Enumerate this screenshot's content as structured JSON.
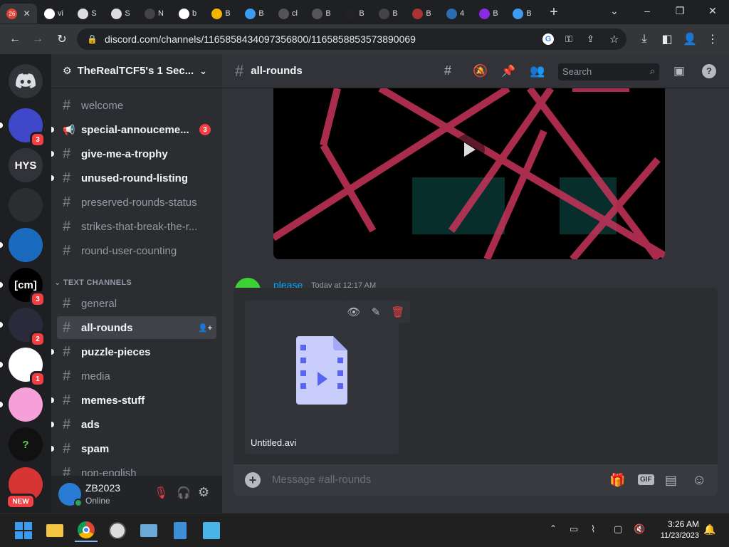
{
  "browser": {
    "tabs": [
      {
        "label": "",
        "badge": "26"
      },
      {
        "label": "vi"
      },
      {
        "label": "S"
      },
      {
        "label": "S"
      },
      {
        "label": "N"
      },
      {
        "label": "b"
      },
      {
        "label": "B"
      },
      {
        "label": "B"
      },
      {
        "label": "cl"
      },
      {
        "label": "B"
      },
      {
        "label": "B"
      },
      {
        "label": "B"
      },
      {
        "label": "B"
      },
      {
        "label": "4"
      },
      {
        "label": "B"
      },
      {
        "label": "B"
      }
    ],
    "url": "discord.com/channels/1165858434097356800/1165858853573890069"
  },
  "servers": [
    {
      "label": "",
      "badge": "3"
    },
    {
      "label": "HYS",
      "badge": ""
    },
    {
      "label": "",
      "badge": ""
    },
    {
      "label": "",
      "badge": ""
    },
    {
      "label": "[cm]",
      "badge": "3"
    },
    {
      "label": "",
      "badge": "2"
    },
    {
      "label": "",
      "badge": "1"
    },
    {
      "label": "",
      "badge": ""
    },
    {
      "label": "?",
      "badge": ""
    },
    {
      "label": "",
      "badge": "NEW"
    }
  ],
  "guild": {
    "name": "TheRealTCF5's 1 Sec..."
  },
  "channels_top": [
    {
      "name": "welcome",
      "state": "read",
      "badge": ""
    },
    {
      "name": "special-annoucеme...",
      "state": "unread",
      "badge": "3"
    },
    {
      "name": "give-me-a-trophy",
      "state": "unread",
      "badge": ""
    },
    {
      "name": "unused-round-listing",
      "state": "unread",
      "badge": ""
    },
    {
      "name": "preserved-rounds-status",
      "state": "read",
      "badge": ""
    },
    {
      "name": "strikes-that-break-the-r...",
      "state": "read",
      "badge": ""
    },
    {
      "name": "round-user-counting",
      "state": "read",
      "badge": ""
    }
  ],
  "category": "TEXT CHANNELS",
  "channels_text": [
    {
      "name": "general",
      "state": "read"
    },
    {
      "name": "all-rounds",
      "state": "selected"
    },
    {
      "name": "puzzle-pieces",
      "state": "unread"
    },
    {
      "name": "media",
      "state": "read"
    },
    {
      "name": "memes-stuff",
      "state": "unread"
    },
    {
      "name": "ads",
      "state": "unread"
    },
    {
      "name": "spam",
      "state": "unread"
    },
    {
      "name": "non-english",
      "state": "read"
    }
  ],
  "user": {
    "name": "ZB2023",
    "status": "Online"
  },
  "channel": {
    "name": "all-rounds",
    "search_placeholder": "Search"
  },
  "message": {
    "author": "please",
    "timestamp": "Today at 12:17 AM"
  },
  "upload": {
    "filename": "Untitled.avi"
  },
  "composer": {
    "placeholder": "Message #all-rounds",
    "gif_label": "GIF"
  },
  "taskbar": {
    "time": "3:26 AM",
    "date": "11/23/2023"
  },
  "colors": {
    "accent": "#5865f2",
    "danger": "#f23f43",
    "online": "#23a55a",
    "link": "#00a8fc"
  }
}
